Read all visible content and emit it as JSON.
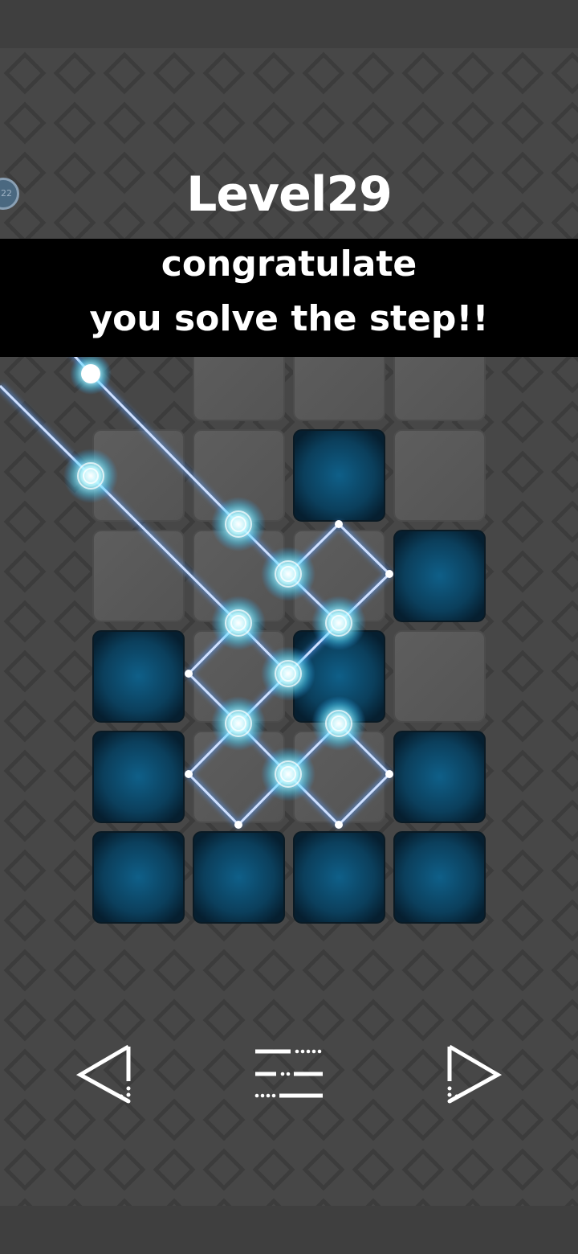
{
  "level": {
    "title": "Level29",
    "badge": "22"
  },
  "banner": {
    "line1": "congratulate",
    "line2": "you solve the step!!"
  },
  "colors": {
    "background": "#474747",
    "tile_gray": "#585858",
    "tile_blue": "#0c4766",
    "laser": "#a9c6ff",
    "glow": "#7fe8ff",
    "banner": "#000000"
  },
  "board": {
    "columns": 4,
    "rows": 6,
    "tiles": [
      [
        "none",
        "gray",
        "gray",
        "gray"
      ],
      [
        "gray",
        "gray",
        "blue",
        "gray"
      ],
      [
        "gray",
        "gray",
        "gray",
        "blue"
      ],
      [
        "blue",
        "gray",
        "blue",
        "gray"
      ],
      [
        "blue",
        "gray",
        "gray",
        "blue"
      ],
      [
        "blue",
        "blue",
        "blue",
        "blue"
      ]
    ]
  },
  "navigation": {
    "prev_icon": "triangle-left-icon",
    "menu_icon": "menu-lines-icon",
    "next_icon": "triangle-right-icon"
  }
}
